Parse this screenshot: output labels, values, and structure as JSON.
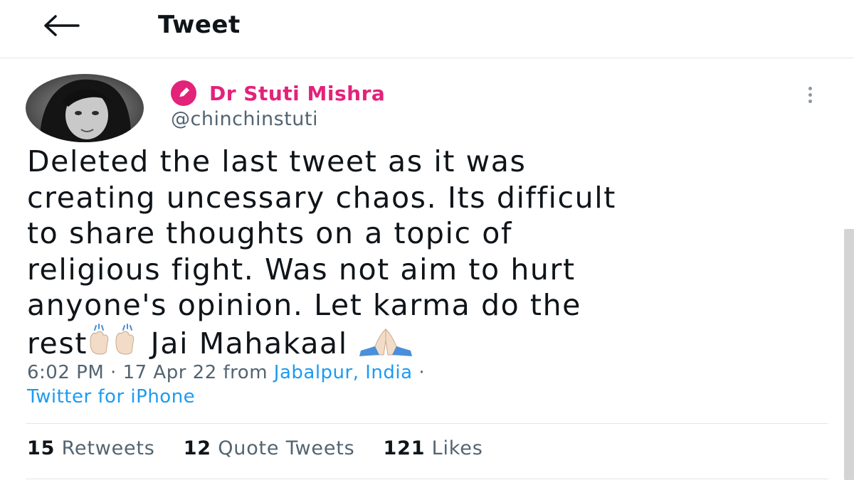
{
  "header": {
    "title": "Tweet",
    "back_icon": "arrow-left-icon"
  },
  "tweet": {
    "author_name": "Dr Stuti Mishra",
    "handle": "@chinchinstuti",
    "badge_icon": "pencil-badge-icon",
    "more_icon": "vertical-ellipsis-icon",
    "text_lines": [
      "Deleted the last tweet as it was",
      "creating uncessary chaos. Its difficult",
      "to share thoughts on a topic of",
      "religious fight. Was not aim to hurt",
      "anyone's opinion. Let karma do the"
    ],
    "last_line_start": "rest",
    "last_line_middle": " Jai Mahakaal ",
    "emoji_raised_hands": "raising-hands-emoji",
    "emoji_folded_hands": "folded-hands-emoji",
    "time": "6:02 PM",
    "separator": " · ",
    "date": "17 Apr 22",
    "from_label": " from ",
    "location": "Jabalpur, India",
    "trailing_separator": " ·",
    "source": "Twitter for iPhone"
  },
  "stats": {
    "retweets_count": "15",
    "retweets_label": " Retweets",
    "quotes_count": "12",
    "quotes_label": " Quote Tweets",
    "likes_count": "121",
    "likes_label": " Likes"
  },
  "colors": {
    "accent_pink": "#e3227a",
    "link_blue": "#1d9bf0",
    "muted_gray": "#536471"
  }
}
